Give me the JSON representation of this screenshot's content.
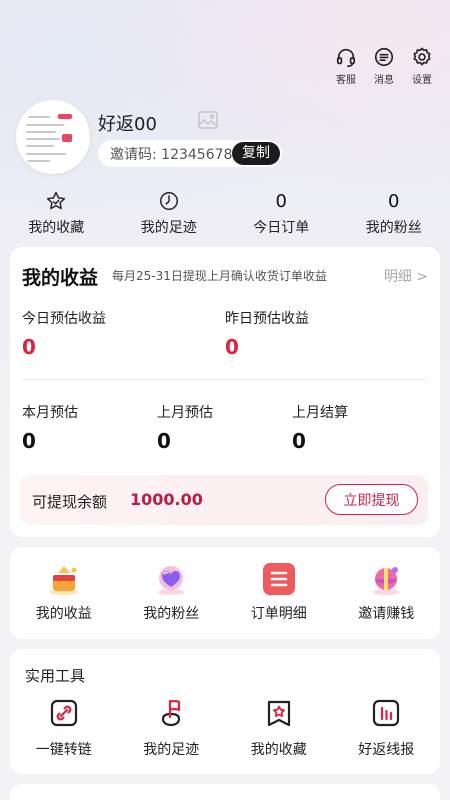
{
  "header": {
    "actions": [
      {
        "label": "客服",
        "icon": "headset-icon"
      },
      {
        "label": "消息",
        "icon": "message-icon"
      },
      {
        "label": "设置",
        "icon": "gear-icon"
      }
    ]
  },
  "profile": {
    "username": "好返00",
    "invite_label": "邀请码: 12345678",
    "copy_label": "复制"
  },
  "stats": [
    {
      "label": "我的收藏",
      "icon": "star-icon"
    },
    {
      "label": "我的足迹",
      "icon": "clock-icon"
    },
    {
      "value": "0",
      "label": "今日订单"
    },
    {
      "value": "0",
      "label": "我的粉丝"
    }
  ],
  "earnings": {
    "title": "我的收益",
    "note": "每月25-31日提现上月确认收货订单收益",
    "detail": "明细 >",
    "today_label": "今日预估收益",
    "today_value": "0",
    "yesterday_label": "昨日预估收益",
    "yesterday_value": "0",
    "this_month_label": "本月预估",
    "this_month_value": "0",
    "last_month_label": "上月预估",
    "last_month_value": "0",
    "settled_label": "上月结算",
    "settled_value": "0",
    "withdraw_label": "可提现余额",
    "withdraw_amount": "1000.00",
    "withdraw_button": "立即提现",
    "accent": "#e0213f"
  },
  "shortcuts": [
    {
      "label": "我的收益",
      "icon": "gift-box-icon"
    },
    {
      "label": "我的粉丝",
      "icon": "heart-icon"
    },
    {
      "label": "订单明细",
      "icon": "order-list-icon"
    },
    {
      "label": "邀请赚钱",
      "icon": "gift-ball-icon"
    }
  ],
  "tools": {
    "title": "实用工具",
    "items": [
      {
        "label": "一键转链",
        "icon": "link-icon"
      },
      {
        "label": "我的足迹",
        "icon": "flag-icon"
      },
      {
        "label": "我的收藏",
        "icon": "favorite-icon"
      },
      {
        "label": "好返线报",
        "icon": "report-icon"
      }
    ]
  }
}
